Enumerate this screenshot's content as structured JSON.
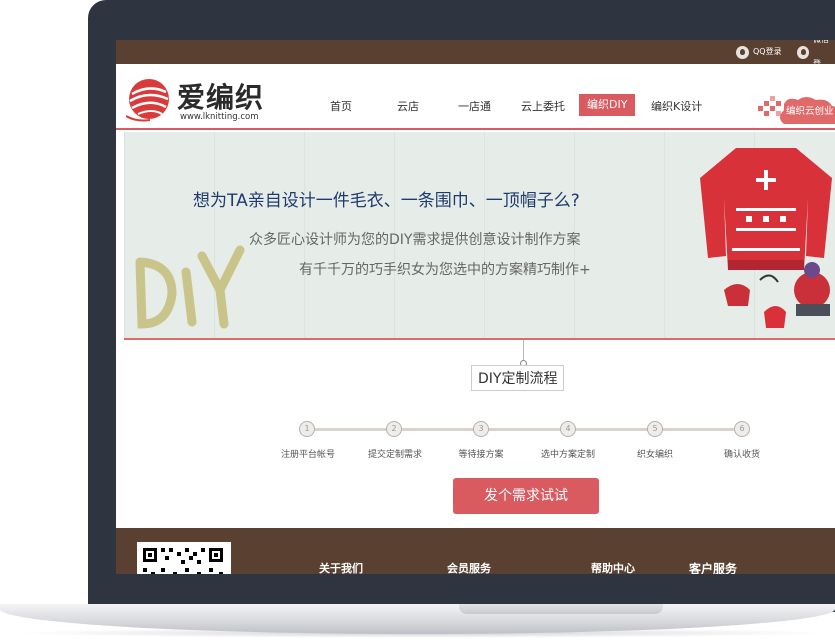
{
  "topbar": {
    "qq_login": "QQ登录",
    "wechat": "微信登"
  },
  "header": {
    "logo_text": "爱编织",
    "logo_url": "www.lknitting.com",
    "nav": [
      "首页",
      "云店",
      "一店通",
      "云上委托",
      "编织DIY",
      "编织K设计"
    ],
    "cloud_badge": "编织云创业"
  },
  "banner": {
    "title": "想为TA亲自设计一件毛衣、一条围巾、一顶帽子么?",
    "line1": "众多匠心设计师为您的DIY需求提供创意设计制作方案",
    "line2": "有千千万的巧手织女为您选中的方案精巧制作+"
  },
  "process": {
    "title": "DIY定制流程",
    "steps": [
      {
        "num": "1",
        "label": "注册平台帐号"
      },
      {
        "num": "2",
        "label": "提交定制需求"
      },
      {
        "num": "3",
        "label": "等待接方案"
      },
      {
        "num": "4",
        "label": "选中方案定制"
      },
      {
        "num": "5",
        "label": "织女编织"
      },
      {
        "num": "6",
        "label": "确认收货"
      }
    ],
    "cta": "发个需求试试"
  },
  "footer": {
    "links": [
      "关于我们",
      "会员服务",
      "帮助中心",
      "客户服务"
    ]
  },
  "colors": {
    "accent": "#d95a5f",
    "frame": "#2f3540",
    "brown": "#5a4030"
  }
}
